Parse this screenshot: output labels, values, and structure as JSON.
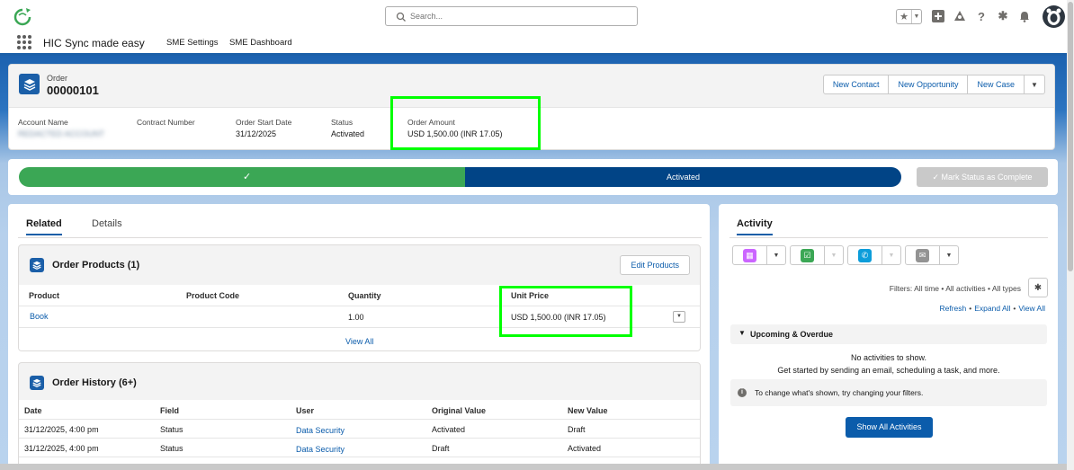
{
  "header": {
    "search_placeholder": "Search...",
    "icons": [
      "favorites-star-icon",
      "chevron-down-icon",
      "add-icon",
      "trailhead-icon",
      "help-icon",
      "setup-gear-icon",
      "notifications-bell-icon",
      "user-avatar"
    ]
  },
  "nav": {
    "app_name": "HIC Sync made easy",
    "items": [
      "SME Settings",
      "SME Dashboard"
    ]
  },
  "record": {
    "type": "Order",
    "name": "00000101",
    "actions": [
      "New Contact",
      "New Opportunity",
      "New Case"
    ],
    "fields": [
      {
        "label": "Account Name",
        "value": "REDACTED ACCOUNT"
      },
      {
        "label": "Contract Number",
        "value": ""
      },
      {
        "label": "Order Start Date",
        "value": "31/12/2025"
      },
      {
        "label": "Status",
        "value": "Activated"
      },
      {
        "label": "Order Amount",
        "value": "USD 1,500.00 (INR 17.05)"
      }
    ]
  },
  "path": {
    "current_stage": "Activated",
    "mark_button": "Mark Status as Complete"
  },
  "tabs": [
    "Related",
    "Details"
  ],
  "order_products": {
    "title": "Order Products (1)",
    "button": "Edit Products",
    "columns": [
      "Product",
      "Product Code",
      "Quantity",
      "Unit Price"
    ],
    "rows": [
      {
        "product": "Book",
        "code": "",
        "quantity": "1.00",
        "unit_price": "USD 1,500.00 (INR 17.05)"
      }
    ],
    "view_all": "View All"
  },
  "order_history": {
    "title": "Order History (6+)",
    "columns": [
      "Date",
      "Field",
      "User",
      "Original Value",
      "New Value"
    ],
    "rows": [
      {
        "date": "31/12/2025, 4:00 pm",
        "field": "Status",
        "user": "Data Security",
        "original": "Activated",
        "new": "Draft"
      },
      {
        "date": "31/12/2025, 4:00 pm",
        "field": "Status",
        "user": "Data Security",
        "original": "Draft",
        "new": "Activated"
      }
    ]
  },
  "activity": {
    "tab": "Activity",
    "filters": "Filters: All time • All activities • All types",
    "links": [
      "Refresh",
      "Expand All",
      "View All"
    ],
    "upcoming": "Upcoming & Overdue",
    "no_activities": "No activities to show.",
    "get_started": "Get started by sending an email, scheduling a task, and more.",
    "info": "To change what's shown, try changing your filters.",
    "show_all_button": "Show All Activities"
  },
  "colors": {
    "brand": "#1b5fa8",
    "path_complete": "#3ba755",
    "path_current": "#014486",
    "annotation_box": "#00ff00"
  }
}
